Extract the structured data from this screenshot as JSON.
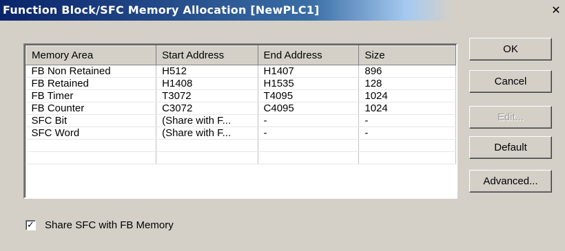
{
  "window": {
    "title": "Function Block/SFC Memory Allocation [NewPLC1]",
    "close_glyph": "✕"
  },
  "table": {
    "columns": [
      "Memory Area",
      "Start Address",
      "End Address",
      "Size"
    ],
    "rows": [
      [
        "FB Non Retained",
        "H512",
        "H1407",
        "896"
      ],
      [
        "FB Retained",
        "H1408",
        "H1535",
        "128"
      ],
      [
        "FB Timer",
        "T3072",
        "T4095",
        "1024"
      ],
      [
        "FB Counter",
        "C3072",
        "C4095",
        "1024"
      ],
      [
        "SFC Bit",
        "(Share with F...",
        "-",
        "-"
      ],
      [
        "SFC Word",
        "(Share with F...",
        "-",
        "-"
      ],
      [
        "",
        "",
        "",
        ""
      ],
      [
        "",
        "",
        "",
        ""
      ]
    ]
  },
  "buttons": {
    "ok": "OK",
    "cancel": "Cancel",
    "edit": "Edit...",
    "default": "Default",
    "advanced": "Advanced..."
  },
  "options": {
    "share_sfc_label": "Share SFC with FB Memory",
    "share_sfc_checked": true,
    "check_glyph": "✓"
  }
}
